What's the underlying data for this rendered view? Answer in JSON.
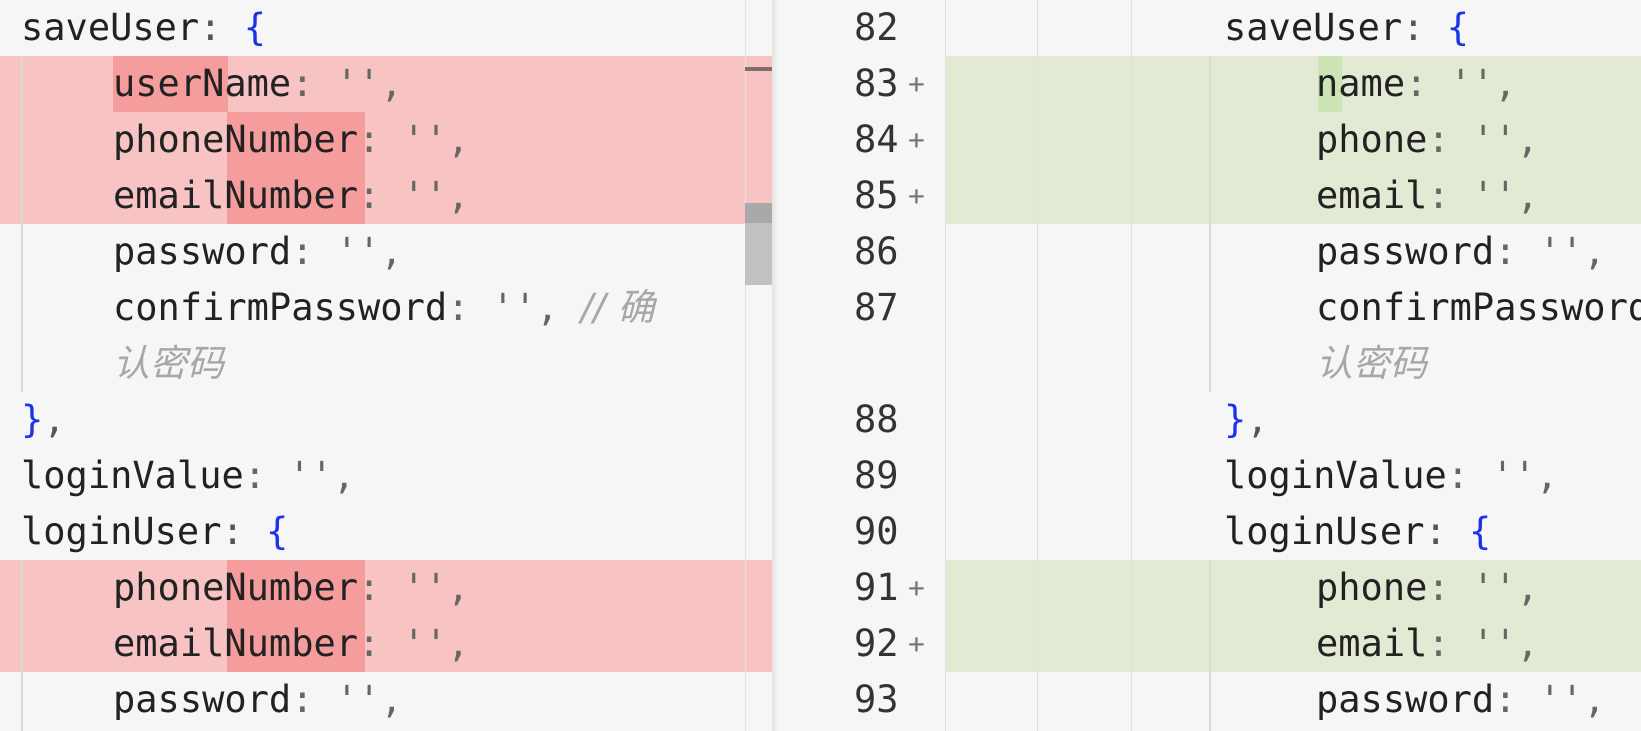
{
  "left_pane": {
    "lines": [
      {
        "key": "saveUser",
        "rest": ": ",
        "brace": "{"
      },
      {
        "key": "userName",
        "rest": ": '',"
      },
      {
        "key": "phoneNumber",
        "rest": ": '',"
      },
      {
        "key": "emailNumber",
        "rest": ": '',"
      },
      {
        "key": "password",
        "rest": ": '',"
      },
      {
        "key": "confirmPassword",
        "rest": ": '', ",
        "comment": "// 确"
      },
      {
        "comment": "认密码"
      },
      {
        "brace": "}",
        "rest": ","
      },
      {
        "key": "loginValue",
        "rest": ": '',"
      },
      {
        "key": "loginUser",
        "rest": ": ",
        "brace": "{"
      },
      {
        "key": "phoneNumber",
        "rest": ": '',"
      },
      {
        "key": "emailNumber",
        "rest": ": '',"
      },
      {
        "key": "password",
        "rest": ": '',"
      }
    ]
  },
  "right_pane": {
    "line_numbers": [
      "82",
      "83",
      "84",
      "85",
      "86",
      "87",
      "88",
      "89",
      "90",
      "91",
      "92",
      "93"
    ],
    "plus_marks": [
      "+",
      "+",
      "+",
      "+",
      "+"
    ],
    "lines": [
      {
        "key": "saveUser",
        "rest": ": ",
        "brace": "{"
      },
      {
        "key": "name",
        "rest": ": '',"
      },
      {
        "key": "phone",
        "rest": ": '',"
      },
      {
        "key": "email",
        "rest": ": '',"
      },
      {
        "key": "password",
        "rest": ": '',"
      },
      {
        "key": "confirmPassword",
        "rest": ""
      },
      {
        "comment": "认密码"
      },
      {
        "brace": "}",
        "rest": ","
      },
      {
        "key": "loginValue",
        "rest": ": '',"
      },
      {
        "key": "loginUser",
        "rest": ": ",
        "brace": "{"
      },
      {
        "key": "phone",
        "rest": ": '',"
      },
      {
        "key": "email",
        "rest": ": '',"
      },
      {
        "key": "password",
        "rest": ": '',"
      }
    ]
  },
  "colors": {
    "deleted_row": "#f7c3c3",
    "deleted_word": "#f59d9d",
    "added_row": "#e3ead4",
    "added_word": "#cde4b4",
    "brace": "#1a32e8"
  }
}
